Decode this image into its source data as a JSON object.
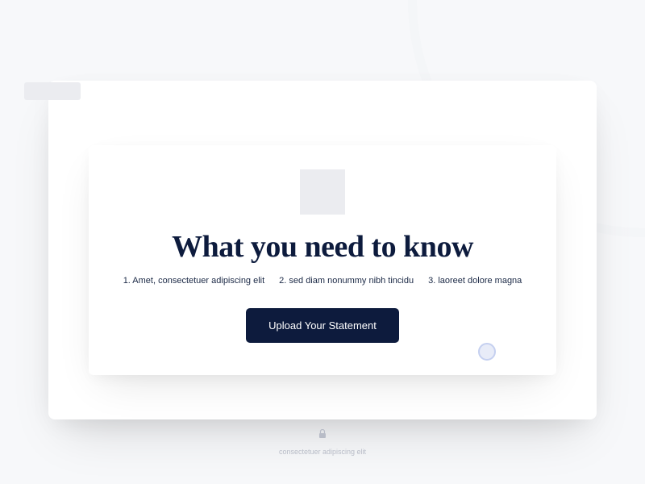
{
  "card": {
    "heading": "What you need to know",
    "steps": [
      "1. Amet, consectetuer adipiscing elit",
      "2. sed diam nonummy nibh tincidu",
      "3. laoreet dolore magna"
    ],
    "button_label": "Upload Your Statement"
  },
  "footer": {
    "text": "consectetuer adipiscing elit"
  }
}
